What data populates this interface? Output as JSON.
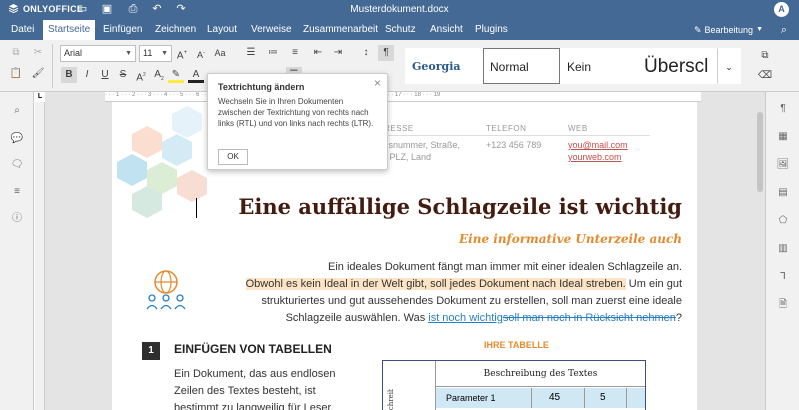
{
  "app": {
    "logo": "ONLYOFFICE",
    "doc_title": "Musterdokument.docx",
    "avatar": "A"
  },
  "menu": {
    "tabs": [
      "Datei",
      "Startseite",
      "Einfügen",
      "Zeichnen",
      "Layout",
      "Verweise",
      "Zusammenarbeit",
      "Schutz",
      "Ansicht",
      "Plugins"
    ],
    "active": "Startseite",
    "edit_mode": "Bearbeitung"
  },
  "toolbar": {
    "font_name": "Arial",
    "font_size": "11",
    "styles": [
      "Georgia",
      "Normal",
      "Kein Abstand",
      "Überscl"
    ],
    "selected_style": "Normal"
  },
  "tooltip": {
    "title": "Textrichtung ändern",
    "body": "Wechseln Sie in Ihren Dokumenten zwischen der Textrichtung von rechts nach links (RTL) und von links nach rechts (LTR).",
    "ok": "OK"
  },
  "document": {
    "contact": {
      "h_adresse": "ADRESSE",
      "h_telefon": "TELEFON",
      "h_web": "WEB",
      "adresse_1": "Hausnummer, Straße,",
      "adresse_2": "Ort, PLZ, Land",
      "telefon": "+123 456 789",
      "web_1": "you@mail.com",
      "web_2": "yourweb.com"
    },
    "heading": "Eine auffällige Schlagzeile ist wichtig",
    "subheading": "Eine informative Unterzeile auch",
    "para_1": "Ein ideales Dokument fängt man immer mit einer idealen Schlagzeile an.",
    "para_2": "Obwohl es kein Ideal in der Welt gibt, soll jedes Dokument nach Ideal streben.",
    "para_2b": " Um ein gut",
    "para_3": "strukturiertes und gut aussehendes Dokument zu erstellen, soll man zuerst eine ideale",
    "para_4a": "Schlagzeile auswählen. Was ",
    "para_4_ins": "ist noch wichtig",
    "para_4_del": "soll man noch in Rücksicht nehmen",
    "para_4b": "?",
    "section_number": "1",
    "section_title": "EINFÜGEN VON TABELLEN",
    "section_body_1": "Ein Dokument, das aus endlosen",
    "section_body_2": "Zeilen des Textes besteht, ist",
    "section_body_3": "bestimmt zu langweilig für Leser.",
    "table_label": "IHRE TABELLE",
    "table_header": "Beschreibung des Textes",
    "table_rowhead": "Beschreibung des",
    "table_row_1": {
      "param": "Parameter 1",
      "v1": "45",
      "v2": "5"
    }
  },
  "colors": {
    "brand": "#446995",
    "heading": "#431c10",
    "accent": "#e38b2d",
    "track": "#2a7fc0"
  }
}
